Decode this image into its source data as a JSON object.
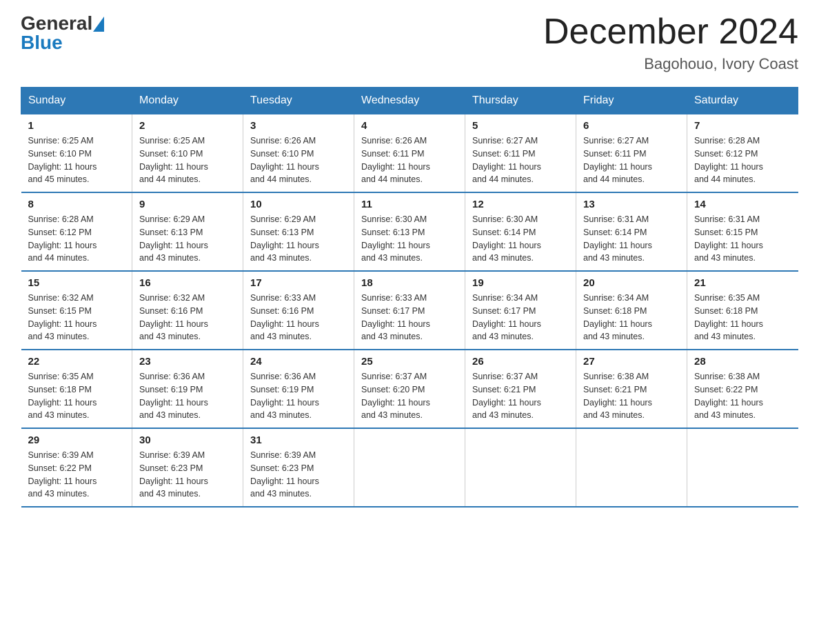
{
  "header": {
    "logo": {
      "general": "General",
      "blue": "Blue"
    },
    "title": "December 2024",
    "location": "Bagohouo, Ivory Coast"
  },
  "calendar": {
    "days_of_week": [
      "Sunday",
      "Monday",
      "Tuesday",
      "Wednesday",
      "Thursday",
      "Friday",
      "Saturday"
    ],
    "weeks": [
      [
        {
          "day": "1",
          "sunrise": "6:25 AM",
          "sunset": "6:10 PM",
          "daylight": "11 hours and 45 minutes."
        },
        {
          "day": "2",
          "sunrise": "6:25 AM",
          "sunset": "6:10 PM",
          "daylight": "11 hours and 44 minutes."
        },
        {
          "day": "3",
          "sunrise": "6:26 AM",
          "sunset": "6:10 PM",
          "daylight": "11 hours and 44 minutes."
        },
        {
          "day": "4",
          "sunrise": "6:26 AM",
          "sunset": "6:11 PM",
          "daylight": "11 hours and 44 minutes."
        },
        {
          "day": "5",
          "sunrise": "6:27 AM",
          "sunset": "6:11 PM",
          "daylight": "11 hours and 44 minutes."
        },
        {
          "day": "6",
          "sunrise": "6:27 AM",
          "sunset": "6:11 PM",
          "daylight": "11 hours and 44 minutes."
        },
        {
          "day": "7",
          "sunrise": "6:28 AM",
          "sunset": "6:12 PM",
          "daylight": "11 hours and 44 minutes."
        }
      ],
      [
        {
          "day": "8",
          "sunrise": "6:28 AM",
          "sunset": "6:12 PM",
          "daylight": "11 hours and 44 minutes."
        },
        {
          "day": "9",
          "sunrise": "6:29 AM",
          "sunset": "6:13 PM",
          "daylight": "11 hours and 43 minutes."
        },
        {
          "day": "10",
          "sunrise": "6:29 AM",
          "sunset": "6:13 PM",
          "daylight": "11 hours and 43 minutes."
        },
        {
          "day": "11",
          "sunrise": "6:30 AM",
          "sunset": "6:13 PM",
          "daylight": "11 hours and 43 minutes."
        },
        {
          "day": "12",
          "sunrise": "6:30 AM",
          "sunset": "6:14 PM",
          "daylight": "11 hours and 43 minutes."
        },
        {
          "day": "13",
          "sunrise": "6:31 AM",
          "sunset": "6:14 PM",
          "daylight": "11 hours and 43 minutes."
        },
        {
          "day": "14",
          "sunrise": "6:31 AM",
          "sunset": "6:15 PM",
          "daylight": "11 hours and 43 minutes."
        }
      ],
      [
        {
          "day": "15",
          "sunrise": "6:32 AM",
          "sunset": "6:15 PM",
          "daylight": "11 hours and 43 minutes."
        },
        {
          "day": "16",
          "sunrise": "6:32 AM",
          "sunset": "6:16 PM",
          "daylight": "11 hours and 43 minutes."
        },
        {
          "day": "17",
          "sunrise": "6:33 AM",
          "sunset": "6:16 PM",
          "daylight": "11 hours and 43 minutes."
        },
        {
          "day": "18",
          "sunrise": "6:33 AM",
          "sunset": "6:17 PM",
          "daylight": "11 hours and 43 minutes."
        },
        {
          "day": "19",
          "sunrise": "6:34 AM",
          "sunset": "6:17 PM",
          "daylight": "11 hours and 43 minutes."
        },
        {
          "day": "20",
          "sunrise": "6:34 AM",
          "sunset": "6:18 PM",
          "daylight": "11 hours and 43 minutes."
        },
        {
          "day": "21",
          "sunrise": "6:35 AM",
          "sunset": "6:18 PM",
          "daylight": "11 hours and 43 minutes."
        }
      ],
      [
        {
          "day": "22",
          "sunrise": "6:35 AM",
          "sunset": "6:18 PM",
          "daylight": "11 hours and 43 minutes."
        },
        {
          "day": "23",
          "sunrise": "6:36 AM",
          "sunset": "6:19 PM",
          "daylight": "11 hours and 43 minutes."
        },
        {
          "day": "24",
          "sunrise": "6:36 AM",
          "sunset": "6:19 PM",
          "daylight": "11 hours and 43 minutes."
        },
        {
          "day": "25",
          "sunrise": "6:37 AM",
          "sunset": "6:20 PM",
          "daylight": "11 hours and 43 minutes."
        },
        {
          "day": "26",
          "sunrise": "6:37 AM",
          "sunset": "6:21 PM",
          "daylight": "11 hours and 43 minutes."
        },
        {
          "day": "27",
          "sunrise": "6:38 AM",
          "sunset": "6:21 PM",
          "daylight": "11 hours and 43 minutes."
        },
        {
          "day": "28",
          "sunrise": "6:38 AM",
          "sunset": "6:22 PM",
          "daylight": "11 hours and 43 minutes."
        }
      ],
      [
        {
          "day": "29",
          "sunrise": "6:39 AM",
          "sunset": "6:22 PM",
          "daylight": "11 hours and 43 minutes."
        },
        {
          "day": "30",
          "sunrise": "6:39 AM",
          "sunset": "6:23 PM",
          "daylight": "11 hours and 43 minutes."
        },
        {
          "day": "31",
          "sunrise": "6:39 AM",
          "sunset": "6:23 PM",
          "daylight": "11 hours and 43 minutes."
        },
        null,
        null,
        null,
        null
      ]
    ],
    "sunrise_label": "Sunrise:",
    "sunset_label": "Sunset:",
    "daylight_label": "Daylight:"
  }
}
